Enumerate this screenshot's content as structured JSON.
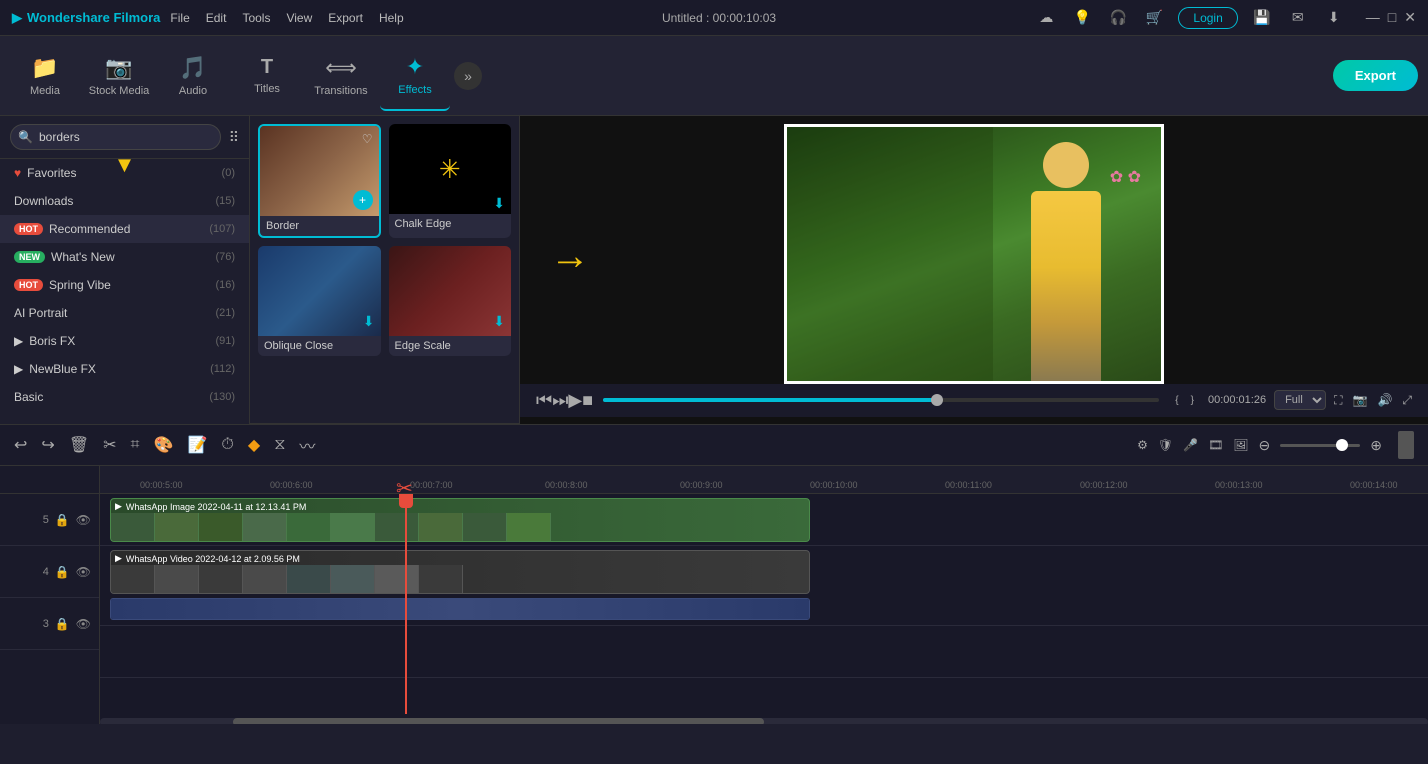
{
  "app": {
    "name": "Wondershare Filmora",
    "title": "Untitled : 00:00:10:03"
  },
  "menu": {
    "items": [
      "File",
      "Edit",
      "Tools",
      "View",
      "Export",
      "Help"
    ]
  },
  "titlebar": {
    "login_label": "Login",
    "win_controls": [
      "—",
      "□",
      "✕"
    ]
  },
  "toolbar": {
    "items": [
      {
        "id": "media",
        "label": "Media",
        "icon": "📁"
      },
      {
        "id": "stock",
        "label": "Stock Media",
        "icon": "🎬"
      },
      {
        "id": "audio",
        "label": "Audio",
        "icon": "🎵"
      },
      {
        "id": "titles",
        "label": "Titles",
        "icon": "T"
      },
      {
        "id": "transitions",
        "label": "Transitions",
        "icon": "⟷"
      },
      {
        "id": "effects",
        "label": "Effects",
        "icon": "✦"
      }
    ],
    "export_label": "Export"
  },
  "effects_panel": {
    "search_placeholder": "borders",
    "sidebar": [
      {
        "label": "Favorites",
        "count": "(0)",
        "icon": "heart"
      },
      {
        "label": "Downloads",
        "count": "(15)"
      },
      {
        "label": "Recommended",
        "count": "(107)",
        "badge": "HOT"
      },
      {
        "label": "What's New",
        "count": "(76)",
        "badge": "NEW"
      },
      {
        "label": "Spring Vibe",
        "count": "(16)",
        "badge": "HOT"
      },
      {
        "label": "AI Portrait",
        "count": "(21)"
      },
      {
        "label": "Boris FX",
        "count": "(91)",
        "expand": true
      },
      {
        "label": "NewBlue FX",
        "count": "(112)",
        "expand": true
      },
      {
        "label": "Basic",
        "count": "(130)"
      }
    ],
    "effects": [
      {
        "id": "border",
        "label": "Border",
        "selected": true
      },
      {
        "id": "chalk-edge",
        "label": "Chalk Edge"
      },
      {
        "id": "oblique-close",
        "label": "Oblique Close"
      },
      {
        "id": "edge-scale",
        "label": "Edge Scale"
      }
    ]
  },
  "preview": {
    "time": "00:00:01:26",
    "quality": "Full",
    "progress_pct": 60
  },
  "timeline": {
    "time_markers": [
      "00:00:5:00",
      "00:00:6:00",
      "00:00:7:00",
      "00:00:8:00",
      "00:00:9:00",
      "00:00:10:00",
      "00:00:11:00",
      "00:00:12:00",
      "00:00:13:00",
      "00:00:14:00"
    ],
    "tracks": [
      {
        "id": "5",
        "clip_label": "WhatsApp Image 2022-04-11 at 12.13.41 PM"
      },
      {
        "id": "4",
        "clip_label": "WhatsApp Video 2022-04-12 at 2.09.56 PM"
      }
    ]
  }
}
